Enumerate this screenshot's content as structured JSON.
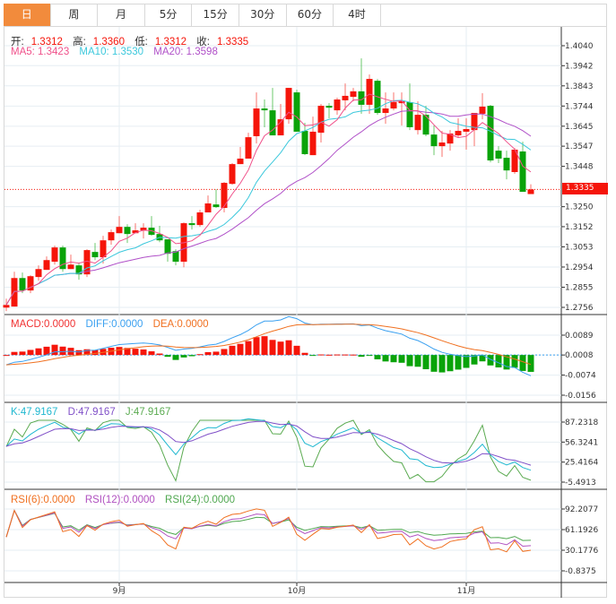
{
  "tabs": [
    {
      "label": "日",
      "active": true
    },
    {
      "label": "周",
      "active": false
    },
    {
      "label": "月",
      "active": false
    },
    {
      "label": "5分",
      "active": false
    },
    {
      "label": "15分",
      "active": false
    },
    {
      "label": "30分",
      "active": false
    },
    {
      "label": "60分",
      "active": false
    },
    {
      "label": "4时",
      "active": false
    }
  ],
  "header": {
    "open_label": "开:",
    "open": "1.3312",
    "high_label": "高:",
    "high": "1.3360",
    "low_label": "低:",
    "low": "1.3312",
    "close_label": "收:",
    "close": "1.3335",
    "ma5": "MA5: 1.3423",
    "ma10": "MA10: 1.3530",
    "ma20": "MA20: 1.3598"
  },
  "colors": {
    "up": "#f5150a",
    "down": "#0aa30a",
    "accent": "#f28b3c",
    "ma5": "#f0508a",
    "ma10": "#3cc8dc",
    "ma20": "#b050c8",
    "macd": "#f03030",
    "diff": "#3aa0f0",
    "dea": "#f07020",
    "k": "#20b8d0",
    "d": "#8050c8",
    "j": "#5aaa50",
    "rsi6": "#f07020",
    "rsi12": "#b050c0",
    "rsi24": "#50a850"
  },
  "chart_data": [
    {
      "type": "candlestick",
      "price_ticks": [
        "1.4040",
        "1.3942",
        "1.3843",
        "1.3744",
        "1.3645",
        "1.3547",
        "1.3448",
        "1.3250",
        "1.3152",
        "1.3053",
        "1.2954",
        "1.2855",
        "1.2756"
      ],
      "ylim": [
        1.2756,
        1.404
      ],
      "current_price": "1.3335",
      "x_labels": [
        {
          "label": "9月",
          "at_candle": 14
        },
        {
          "label": "10月",
          "at_candle": 36
        },
        {
          "label": "11月",
          "at_candle": 57
        }
      ],
      "ohlc": [
        [
          1.2755,
          1.2799,
          1.2738,
          1.2768
        ],
        [
          1.276,
          1.2931,
          1.276,
          1.29
        ],
        [
          1.29,
          1.2927,
          1.2826,
          1.2839
        ],
        [
          1.2839,
          1.2914,
          1.2826,
          1.2909
        ],
        [
          1.2905,
          1.2962,
          1.2887,
          1.2944
        ],
        [
          1.294,
          1.3006,
          1.294,
          1.2988
        ],
        [
          1.298,
          1.3059,
          1.2966,
          1.305
        ],
        [
          1.305,
          1.3059,
          1.2931,
          1.2944
        ],
        [
          1.2944,
          1.3015,
          1.2944,
          1.2966
        ],
        [
          1.2962,
          1.2975,
          1.2892,
          1.2918
        ],
        [
          1.2918,
          1.3041,
          1.2905,
          1.3037
        ],
        [
          1.3028,
          1.3072,
          1.2988,
          1.3002
        ],
        [
          1.3002,
          1.3107,
          1.2971,
          1.3085
        ],
        [
          1.3085,
          1.3138,
          1.3063,
          1.3125
        ],
        [
          1.312,
          1.3204,
          1.312,
          1.3151
        ],
        [
          1.3151,
          1.3164,
          1.3072,
          1.3116
        ],
        [
          1.312,
          1.3169,
          1.312,
          1.3134
        ],
        [
          1.3134,
          1.3169,
          1.3094,
          1.3147
        ],
        [
          1.3147,
          1.3204,
          1.3107,
          1.3112
        ],
        [
          1.3116,
          1.3156,
          1.3076,
          1.3085
        ],
        [
          1.309,
          1.309,
          1.298,
          1.3019
        ],
        [
          1.3032,
          1.3041,
          1.2962,
          1.298
        ],
        [
          1.298,
          1.3173,
          1.2953,
          1.3169
        ],
        [
          1.3169,
          1.3204,
          1.3138,
          1.316
        ],
        [
          1.316,
          1.3235,
          1.3151,
          1.3222
        ],
        [
          1.3222,
          1.3305,
          1.3222,
          1.3266
        ],
        [
          1.3261,
          1.3336,
          1.3244,
          1.3248
        ],
        [
          1.3244,
          1.3371,
          1.3222,
          1.3367
        ],
        [
          1.3362,
          1.3464,
          1.3358,
          1.3459
        ],
        [
          1.3459,
          1.3543,
          1.3459,
          1.3486
        ],
        [
          1.3486,
          1.3613,
          1.3486,
          1.3591
        ],
        [
          1.3596,
          1.3811,
          1.356,
          1.3732
        ],
        [
          1.3732,
          1.3776,
          1.364,
          1.3723
        ],
        [
          1.3723,
          1.3833,
          1.36,
          1.36
        ],
        [
          1.36,
          1.3754,
          1.36,
          1.3679
        ],
        [
          1.3679,
          1.3833,
          1.3657,
          1.3833
        ],
        [
          1.3811,
          1.3824,
          1.3618,
          1.3618
        ],
        [
          1.3622,
          1.3662,
          1.3503,
          1.3508
        ],
        [
          1.3503,
          1.3692,
          1.3503,
          1.3618
        ],
        [
          1.3613,
          1.3754,
          1.3565,
          1.3745
        ],
        [
          1.3745,
          1.3758,
          1.3684,
          1.3736
        ],
        [
          1.3723,
          1.3785,
          1.3701,
          1.3776
        ],
        [
          1.3772,
          1.3855,
          1.3723,
          1.3794
        ],
        [
          1.3789,
          1.3833,
          1.3767,
          1.3816
        ],
        [
          1.3816,
          1.3978,
          1.3706,
          1.375
        ],
        [
          1.375,
          1.3899,
          1.3706,
          1.3877
        ],
        [
          1.3868,
          1.3877,
          1.3701,
          1.371
        ],
        [
          1.371,
          1.3811,
          1.3657,
          1.3732
        ],
        [
          1.3732,
          1.3811,
          1.3723,
          1.3763
        ],
        [
          1.3758,
          1.3811,
          1.3648,
          1.3767
        ],
        [
          1.3763,
          1.3855,
          1.3626,
          1.364
        ],
        [
          1.3626,
          1.3767,
          1.3604,
          1.3701
        ],
        [
          1.3701,
          1.3745,
          1.3596,
          1.3604
        ],
        [
          1.3604,
          1.3648,
          1.3503,
          1.3547
        ],
        [
          1.3547,
          1.3622,
          1.3494,
          1.3565
        ],
        [
          1.356,
          1.3626,
          1.3525,
          1.3609
        ],
        [
          1.36,
          1.3684,
          1.3591,
          1.3622
        ],
        [
          1.3618,
          1.3684,
          1.353,
          1.3631
        ],
        [
          1.3626,
          1.371,
          1.3547,
          1.371
        ],
        [
          1.3706,
          1.3807,
          1.3679,
          1.3741
        ],
        [
          1.3745,
          1.375,
          1.3468,
          1.3477
        ],
        [
          1.3525,
          1.3547,
          1.3464,
          1.3486
        ],
        [
          1.349,
          1.3525,
          1.3384,
          1.3428
        ],
        [
          1.342,
          1.3538,
          1.3411,
          1.353
        ],
        [
          1.3521,
          1.3569,
          1.3323,
          1.3323
        ],
        [
          1.3312,
          1.336,
          1.3312,
          1.3335
        ]
      ]
    },
    {
      "type": "macd",
      "legend": {
        "macd": "MACD:0.0000",
        "diff": "DIFF:0.0000",
        "dea": "DEA:0.0000"
      },
      "ticks": [
        "0.0089",
        "0.0008",
        "-0.0074",
        "-0.0156"
      ],
      "ylim": [
        -0.0156,
        0.0089
      ]
    },
    {
      "type": "kdj",
      "legend": {
        "k": "K:47.9167",
        "d": "D:47.9167",
        "j": "J:47.9167"
      },
      "ticks": [
        "87.2318",
        "56.3241",
        "25.4164",
        "-5.4913"
      ],
      "ylim": [
        -5.4913,
        87.2318
      ]
    },
    {
      "type": "rsi",
      "legend": {
        "rsi6": "RSI(6):0.0000",
        "rsi12": "RSI(12):0.0000",
        "rsi24": "RSI(24):0.0000"
      },
      "ticks": [
        "92.2077",
        "61.1926",
        "30.1776",
        "-0.8375"
      ],
      "ylim": [
        -0.8375,
        92.2077
      ]
    }
  ]
}
